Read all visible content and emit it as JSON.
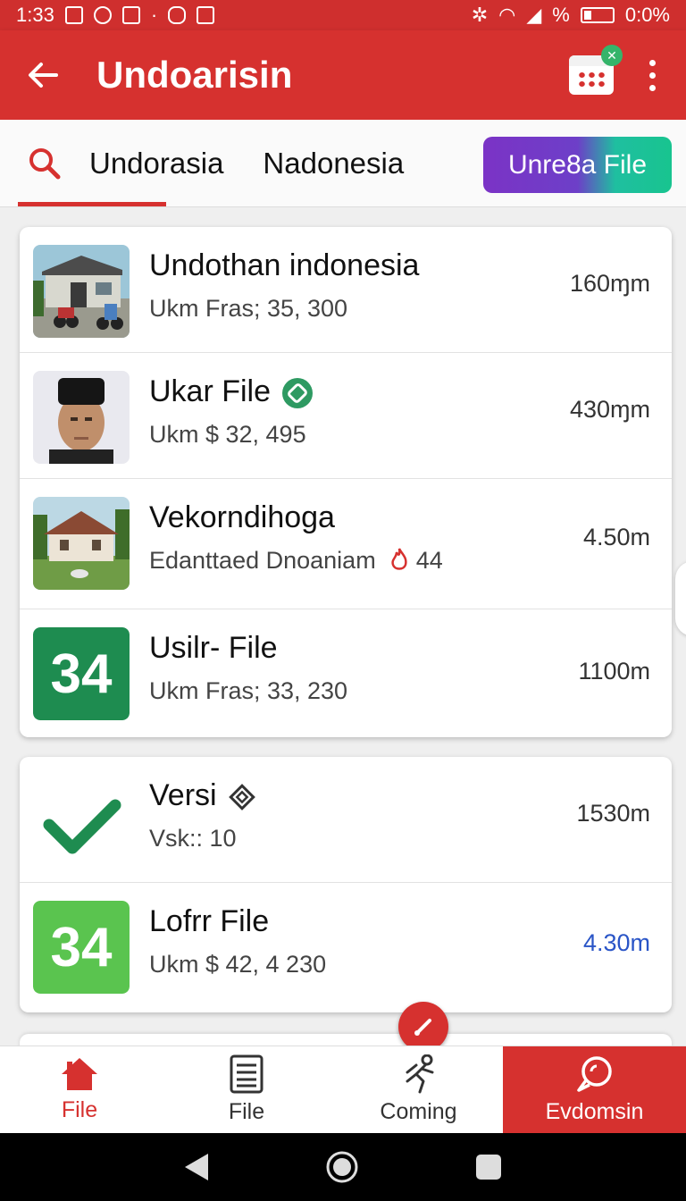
{
  "status_bar": {
    "time": "1:33",
    "battery_text": "%",
    "data_text": "0:0%"
  },
  "app_bar": {
    "title": "Undoarisin",
    "back_icon": "arrow-left-icon",
    "calendar_icon": "calendar-icon",
    "more_icon": "more-vert-icon"
  },
  "tabs": {
    "items": [
      "Undorasia",
      "Nadonesia"
    ],
    "pill_label": "Unre8a File",
    "active_index": 0
  },
  "list_card_1": [
    {
      "name": "Undothan indonesia",
      "sub": "Ukm Fras; 35, 300",
      "distance": "160ɱm"
    },
    {
      "name": "Ukar File",
      "sub": "Ukm $ 32, 495",
      "distance": "430ɱm"
    },
    {
      "name": "Vekorndihoga",
      "sub": "Edanttaed Dnoaniam",
      "sub_extra": "44",
      "distance": "4.50m"
    },
    {
      "name": "Usilr- File",
      "sub": "Ukm Fras; 33, 230",
      "distance": "1100m",
      "tile": "34"
    }
  ],
  "list_card_2": [
    {
      "name": "Versi",
      "sub": "Vsk:: 10",
      "distance": "1530m"
    },
    {
      "name": "Lofrr File",
      "sub": "Ukm $ 42, 4 230",
      "distance": "4.30m",
      "tile": "34"
    }
  ],
  "bottom_nav": [
    {
      "label": "File",
      "icon": "home-icon"
    },
    {
      "label": "File",
      "icon": "document-list-icon"
    },
    {
      "label": "Coming",
      "icon": "person-run-icon"
    },
    {
      "label": "Evdomsin",
      "icon": "search-bubble-icon"
    }
  ],
  "colors": {
    "primary": "#d6312f",
    "tile_dark_green": "#1e8c50",
    "tile_light_green": "#5ac44f",
    "check_green": "#1e8c50",
    "link_blue": "#2a55c7"
  }
}
